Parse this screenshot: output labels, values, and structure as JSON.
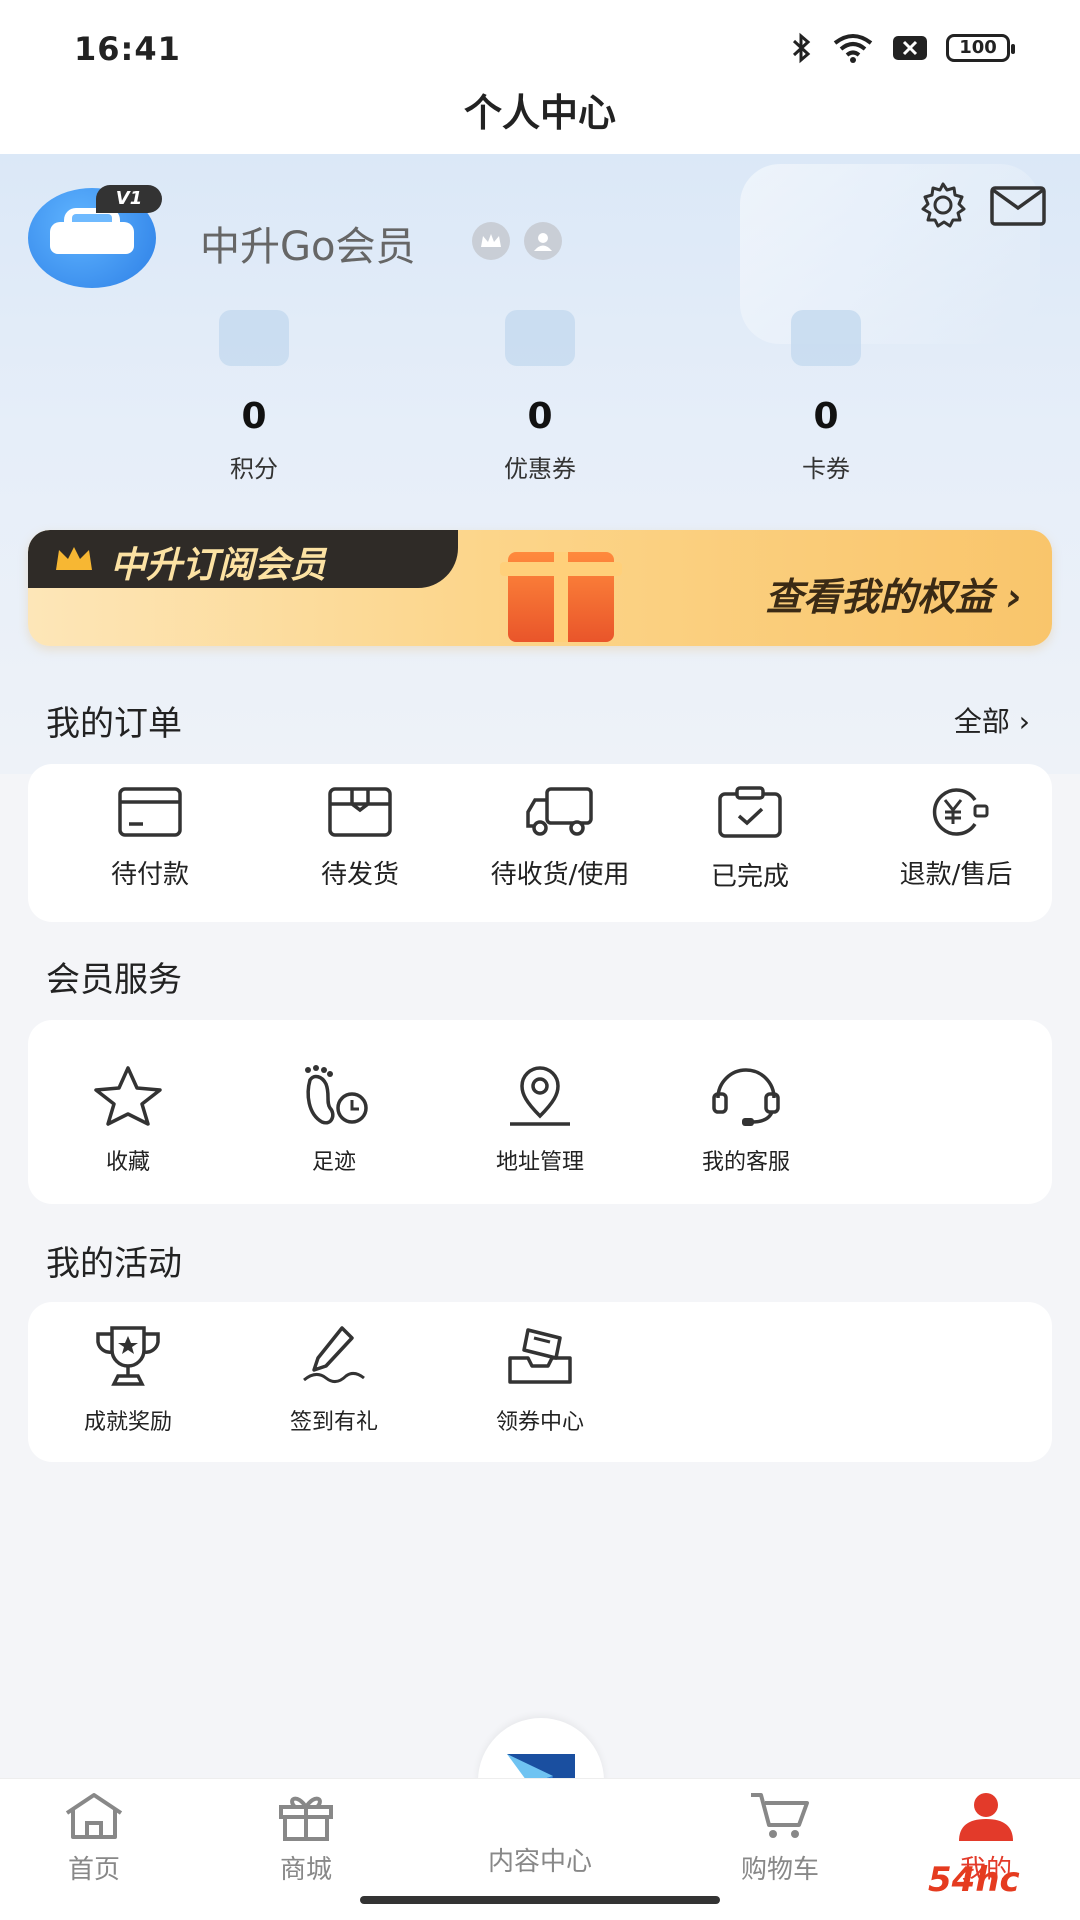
{
  "status_bar": {
    "time": "16:41",
    "battery": "100"
  },
  "header": {
    "title": "个人中心"
  },
  "profile": {
    "username": "中升Go会员",
    "level_badge": "V1"
  },
  "stats": [
    {
      "value": "0",
      "label": "积分",
      "icon": "points-coin-icon"
    },
    {
      "value": "0",
      "label": "优惠券",
      "icon": "coupon-ticket-icon"
    },
    {
      "value": "0",
      "label": "卡券",
      "icon": "card-wallet-icon"
    }
  ],
  "banner": {
    "title": "中升订阅会员",
    "cta": "查看我的权益 ›"
  },
  "orders": {
    "title": "我的订单",
    "more": "全部 ›",
    "items": [
      {
        "label": "待付款",
        "icon": "card-icon"
      },
      {
        "label": "待发货",
        "icon": "box-icon"
      },
      {
        "label": "待收货/使用",
        "icon": "truck-icon"
      },
      {
        "label": "已完成",
        "icon": "clipboard-check-icon"
      },
      {
        "label": "退款/售后",
        "icon": "refund-yen-icon"
      }
    ]
  },
  "member_services": {
    "title": "会员服务",
    "items": [
      {
        "label": "收藏",
        "icon": "star-icon"
      },
      {
        "label": "足迹",
        "icon": "footprint-icon"
      },
      {
        "label": "地址管理",
        "icon": "location-pin-icon"
      },
      {
        "label": "我的客服",
        "icon": "headset-icon"
      }
    ]
  },
  "activities": {
    "title": "我的活动",
    "items": [
      {
        "label": "成就奖励",
        "icon": "trophy-icon"
      },
      {
        "label": "签到有礼",
        "icon": "pen-sign-icon"
      },
      {
        "label": "领券中心",
        "icon": "coupon-center-icon"
      }
    ]
  },
  "tabbar": {
    "items": [
      {
        "label": "首页",
        "icon": "home-icon"
      },
      {
        "label": "商城",
        "icon": "gift-icon"
      },
      {
        "label": "内容中心",
        "icon": "content-logo-icon"
      },
      {
        "label": "购物车",
        "icon": "cart-icon"
      },
      {
        "label": "我的",
        "icon": "user-icon",
        "active": true
      }
    ]
  },
  "watermark": "54hc",
  "colors": {
    "accent": "#e33a2a",
    "hero_bg": "#dbe8f7",
    "banner_gold": "#fcd58a"
  }
}
